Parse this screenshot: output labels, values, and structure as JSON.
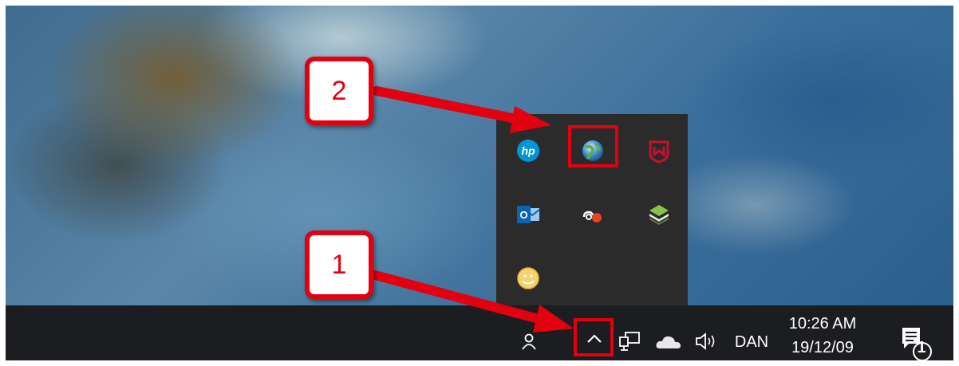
{
  "callouts": {
    "step1": "1",
    "step2": "2"
  },
  "tray_popup": {
    "icons": [
      "hp-icon",
      "globe-icon",
      "mcafee-icon",
      "outlook-icon",
      "cloud-sync-icon",
      "layers-icon",
      "smiley-icon"
    ],
    "hp_label": "hp",
    "outlook_label": "O"
  },
  "taskbar": {
    "language": "DAN",
    "time": "10:26 AM",
    "date": "19/12/09",
    "notification_count": "1"
  },
  "colors": {
    "highlight": "#e3000f",
    "taskbar": "#1c1d20",
    "popup": "#2b2b2b"
  }
}
